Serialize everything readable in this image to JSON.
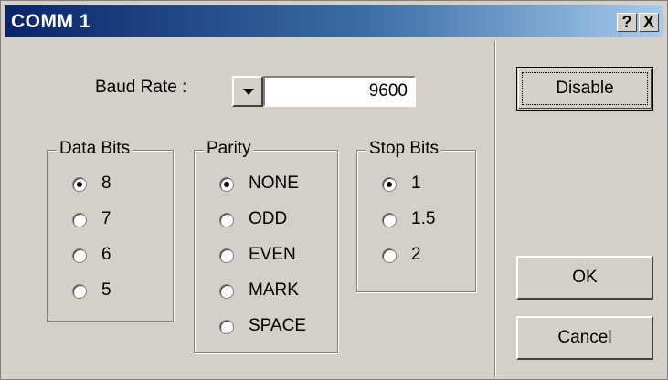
{
  "window": {
    "title": "COMM 1",
    "help_label": "?",
    "close_label": "X"
  },
  "baud": {
    "label": "Baud Rate :",
    "value": "9600"
  },
  "data_bits": {
    "title": "Data Bits",
    "options": [
      "8",
      "7",
      "6",
      "5"
    ],
    "selected": "8"
  },
  "parity": {
    "title": "Parity",
    "options": [
      "NONE",
      "ODD",
      "EVEN",
      "MARK",
      "SPACE"
    ],
    "selected": "NONE"
  },
  "stop_bits": {
    "title": "Stop Bits",
    "options": [
      "1",
      "1.5",
      "2"
    ],
    "selected": "1"
  },
  "buttons": {
    "disable": "Disable",
    "ok": "OK",
    "cancel": "Cancel"
  },
  "icons": {
    "dropdown": "chevron-down-icon",
    "radio_selected": "radio-dot-icon"
  },
  "colors": {
    "title_bar_start": "#0a246a",
    "title_bar_end": "#a6caf0",
    "dialog_face": "#d4d0c8"
  }
}
